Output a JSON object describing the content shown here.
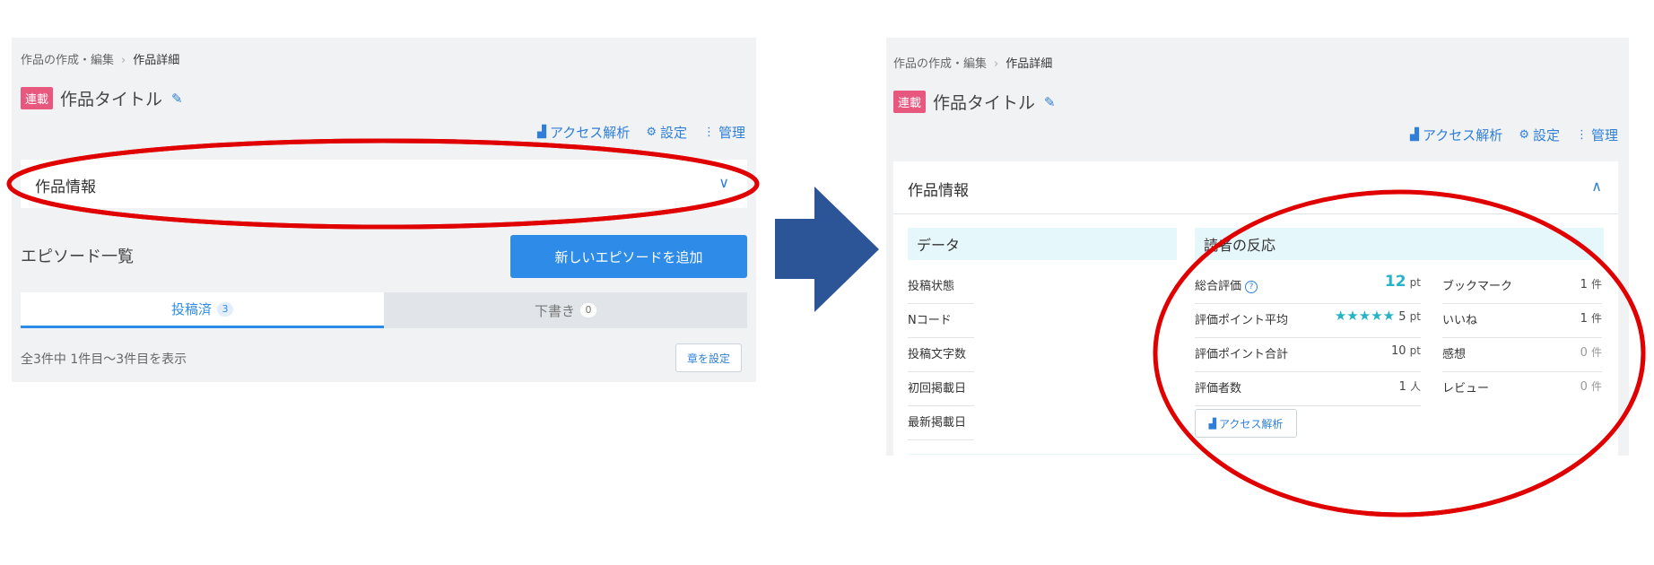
{
  "left": {
    "breadcrumb": {
      "parent": "作品の作成・編集",
      "sep": "›",
      "current": "作品詳細"
    },
    "badge": "連載",
    "work_title": "作品タイトル",
    "actions": {
      "access": "アクセス解析",
      "settings": "設定",
      "manage": "管理"
    },
    "info_bar": {
      "label": "作品情報",
      "chevron": "∨"
    },
    "episodes_title": "エピソード一覧",
    "add_button": "新しいエピソードを追加",
    "tabs": [
      {
        "label": "投稿済",
        "count": "3"
      },
      {
        "label": "下書き",
        "count": "0"
      }
    ],
    "count_text": "全3件中 1件目〜3件目を表示",
    "chapter_button": "章を設定"
  },
  "right": {
    "breadcrumb": {
      "parent": "作品の作成・編集",
      "sep": "›",
      "current": "作品詳細"
    },
    "badge": "連載",
    "work_title": "作品タイトル",
    "actions": {
      "access": "アクセス解析",
      "settings": "設定",
      "manage": "管理"
    },
    "info_header": {
      "label": "作品情報",
      "chevron": "∧"
    },
    "data_section": {
      "title": "データ",
      "rows": [
        "投稿状態",
        "Nコード",
        "投稿文字数",
        "初回掲載日",
        "最新掲載日"
      ]
    },
    "reaction_section": {
      "title": "読者の反応",
      "left_rows": [
        {
          "label": "総合評価",
          "value": "12",
          "unit": "pt"
        },
        {
          "label": "評価ポイント平均",
          "value": "5",
          "unit": "pt",
          "stars": 5
        },
        {
          "label": "評価ポイント合計",
          "value": "10",
          "unit": "pt"
        },
        {
          "label": "評価者数",
          "value": "1",
          "unit": "人"
        }
      ],
      "right_rows": [
        {
          "label": "ブックマーク",
          "value": "1",
          "unit": "件"
        },
        {
          "label": "いいね",
          "value": "1",
          "unit": "件"
        },
        {
          "label": "感想",
          "value": "0",
          "unit": "件"
        },
        {
          "label": "レビュー",
          "value": "0",
          "unit": "件"
        }
      ],
      "access_button": "アクセス解析"
    }
  },
  "colors": {
    "accent": "#2f7fd8",
    "badge": "#e8577e",
    "annotation_red": "#e00000",
    "arrow": "#2c5597",
    "teal": "#26b3c8"
  }
}
